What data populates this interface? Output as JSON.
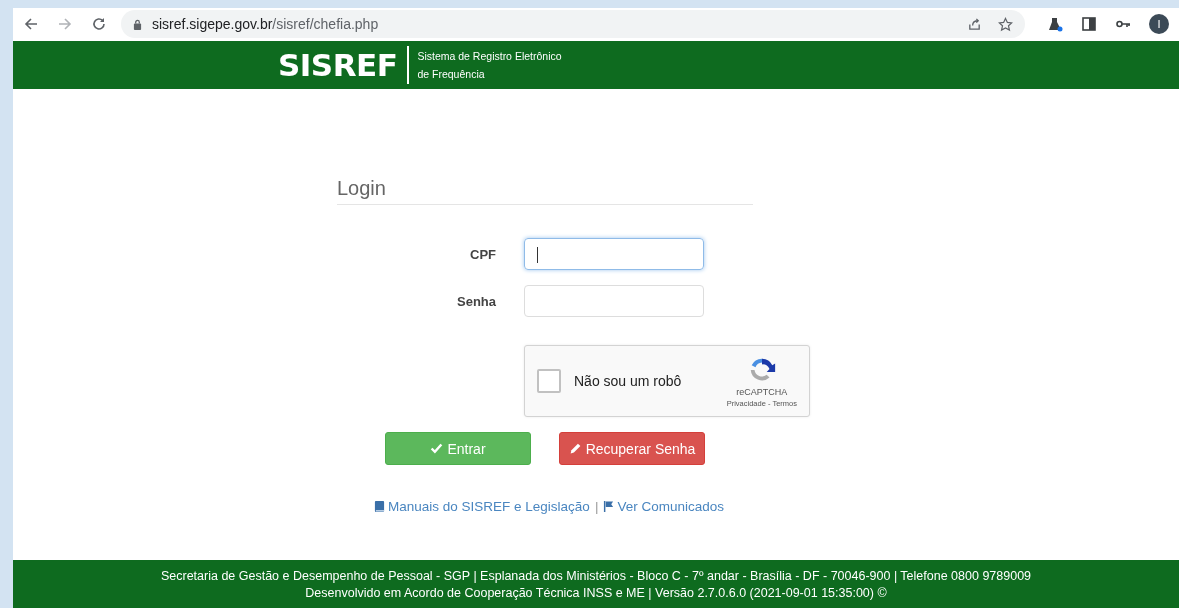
{
  "browser": {
    "url_host": "sisref.sigepe.gov.br",
    "url_path": "/sisref/chefia.php",
    "profile_initial": "I"
  },
  "header": {
    "logo": "SISREF",
    "subtitle_lines": [
      "Sistema de Registro Eletrônico",
      "de Frequência"
    ]
  },
  "login": {
    "title": "Login",
    "fields": [
      {
        "label": "CPF",
        "focused": true
      },
      {
        "label": "Senha",
        "focused": false
      }
    ],
    "captcha": {
      "label": "Não sou um robô",
      "checked": false,
      "brand": "reCAPTCHA",
      "links": "Privacidade - Termos"
    },
    "buttons": [
      {
        "kind": "success",
        "label": "Entrar"
      },
      {
        "kind": "danger",
        "label": "Recuperar Senha"
      }
    ],
    "links": [
      {
        "kind": "book",
        "label": "Manuais do SISREF e Legislação"
      },
      {
        "kind": "flag",
        "label": "Ver Comunicados"
      }
    ],
    "link_separator": "|"
  },
  "footer": {
    "lines": [
      "Secretaria de Gestão e Desempenho de Pessoal - SGP | Esplanada dos Ministérios - Bloco C - 7º andar - Brasília - DF - 70046-900 | Telefone 0800 9789009",
      "Desenvolvido em Acordo de Cooperação Técnica INSS e ME | Versão 2.7.0.6.0 (2021-09-01 15:35:00) ©"
    ]
  }
}
